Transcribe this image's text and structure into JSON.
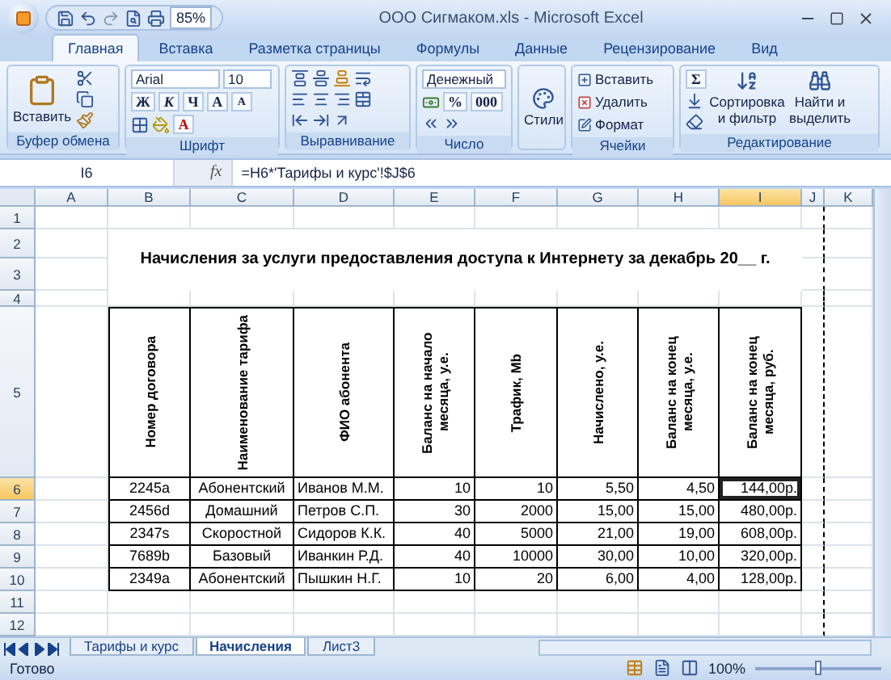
{
  "window": {
    "title": "ООО Сигмаком.xls - Microsoft Excel",
    "zoom": "85%"
  },
  "tabs": [
    {
      "label": "Главная",
      "selected": true
    },
    {
      "label": "Вставка",
      "selected": false
    },
    {
      "label": "Разметка страницы",
      "selected": false
    },
    {
      "label": "Формулы",
      "selected": false
    },
    {
      "label": "Данные",
      "selected": false
    },
    {
      "label": "Рецензирование",
      "selected": false
    },
    {
      "label": "Вид",
      "selected": false
    }
  ],
  "ribbon": {
    "clipboard": {
      "name": "Буфер обмена",
      "paste": "Вставить"
    },
    "font": {
      "name": "Шрифт",
      "font": "Arial",
      "size": "10",
      "bold": "Ж",
      "italic": "К",
      "underline": "Ч",
      "grow": "A",
      "shrink": "A",
      "font_color_letter": "A"
    },
    "alignment": {
      "name": "Выравнивание"
    },
    "number": {
      "name": "Число",
      "format": "Денежный",
      "percent": "%",
      "thousands": "000"
    },
    "styles": {
      "label": "Стили"
    },
    "cells": {
      "name": "Ячейки",
      "items": [
        "Вставить",
        "Удалить",
        "Формат"
      ]
    },
    "editing": {
      "name": "Редактирование",
      "sum": "Σ",
      "sort": "Сортировка и фильтр",
      "find": "Найти и выделить"
    }
  },
  "formula_bar": {
    "name_box": "I6",
    "fx": "fx",
    "formula": "=H6*'Тарифы и курс'!$J$6"
  },
  "columns": [
    {
      "label": "A",
      "selected": false
    },
    {
      "label": "B",
      "selected": false
    },
    {
      "label": "C",
      "selected": false
    },
    {
      "label": "D",
      "selected": false
    },
    {
      "label": "E",
      "selected": false
    },
    {
      "label": "F",
      "selected": false
    },
    {
      "label": "G",
      "selected": false
    },
    {
      "label": "H",
      "selected": false
    },
    {
      "label": "I",
      "selected": true
    },
    {
      "label": "J",
      "selected": false
    },
    {
      "label": "K",
      "selected": false
    }
  ],
  "row_numbers": [
    {
      "label": "1",
      "selected": false
    },
    {
      "label": "2",
      "selected": false
    },
    {
      "label": "3",
      "selected": false
    },
    {
      "label": "4",
      "selected": false
    },
    {
      "label": "5",
      "selected": false
    },
    {
      "label": "6",
      "selected": true
    },
    {
      "label": "7",
      "selected": false
    },
    {
      "label": "8",
      "selected": false
    },
    {
      "label": "9",
      "selected": false
    },
    {
      "label": "10",
      "selected": false
    },
    {
      "label": "11",
      "selected": false
    },
    {
      "label": "12",
      "selected": false
    }
  ],
  "sheet": {
    "title": "Начисления за услуги предоставления доступа к Интернету за декабрь 20__ г.",
    "headers": [
      "Номер договора",
      "Наименование тарифа",
      "ФИО абонента",
      "Баланс на начало месяца, у.е.",
      "Трафик, Mb",
      "Начислено, у.е.",
      "Баланс на конец месяца, у.е.",
      "Баланс на конец месяца, руб."
    ],
    "rows": [
      {
        "cells": [
          {
            "text": "2245a",
            "selected": false
          },
          {
            "text": "Абонентский",
            "selected": false
          },
          {
            "text": "Иванов М.М.",
            "selected": false
          },
          {
            "text": "10",
            "selected": false
          },
          {
            "text": "10",
            "selected": false
          },
          {
            "text": "5,50",
            "selected": false
          },
          {
            "text": "4,50",
            "selected": false
          },
          {
            "text": "144,00р.",
            "selected": true
          }
        ]
      },
      {
        "cells": [
          {
            "text": "2456d",
            "selected": false
          },
          {
            "text": "Домашний",
            "selected": false
          },
          {
            "text": "Петров С.П.",
            "selected": false
          },
          {
            "text": "30",
            "selected": false
          },
          {
            "text": "2000",
            "selected": false
          },
          {
            "text": "15,00",
            "selected": false
          },
          {
            "text": "15,00",
            "selected": false
          },
          {
            "text": "480,00р.",
            "selected": false
          }
        ]
      },
      {
        "cells": [
          {
            "text": "2347s",
            "selected": false
          },
          {
            "text": "Скоростной",
            "selected": false
          },
          {
            "text": "Сидоров К.К.",
            "selected": false
          },
          {
            "text": "40",
            "selected": false
          },
          {
            "text": "5000",
            "selected": false
          },
          {
            "text": "21,00",
            "selected": false
          },
          {
            "text": "19,00",
            "selected": false
          },
          {
            "text": "608,00р.",
            "selected": false
          }
        ]
      },
      {
        "cells": [
          {
            "text": "7689b",
            "selected": false
          },
          {
            "text": "Базовый",
            "selected": false
          },
          {
            "text": "Иванкин Р.Д.",
            "selected": false
          },
          {
            "text": "40",
            "selected": false
          },
          {
            "text": "10000",
            "selected": false
          },
          {
            "text": "30,00",
            "selected": false
          },
          {
            "text": "10,00",
            "selected": false
          },
          {
            "text": "320,00р.",
            "selected": false
          }
        ]
      },
      {
        "cells": [
          {
            "text": "2349a",
            "selected": false
          },
          {
            "text": "Абонентский",
            "selected": false
          },
          {
            "text": "Пышкин Н.Г.",
            "selected": false
          },
          {
            "text": "10",
            "selected": false
          },
          {
            "text": "20",
            "selected": false
          },
          {
            "text": "6,00",
            "selected": false
          },
          {
            "text": "4,00",
            "selected": false
          },
          {
            "text": "128,00р.",
            "selected": false
          }
        ]
      }
    ]
  },
  "sheet_tabs": [
    {
      "label": "Тарифы и курс",
      "selected": false
    },
    {
      "label": "Начисления",
      "selected": true
    },
    {
      "label": "Лист3",
      "selected": false
    }
  ],
  "status_bar": {
    "status": "Готово",
    "zoom": "100%",
    "zoom_slider": {
      "level": 0.5
    }
  }
}
